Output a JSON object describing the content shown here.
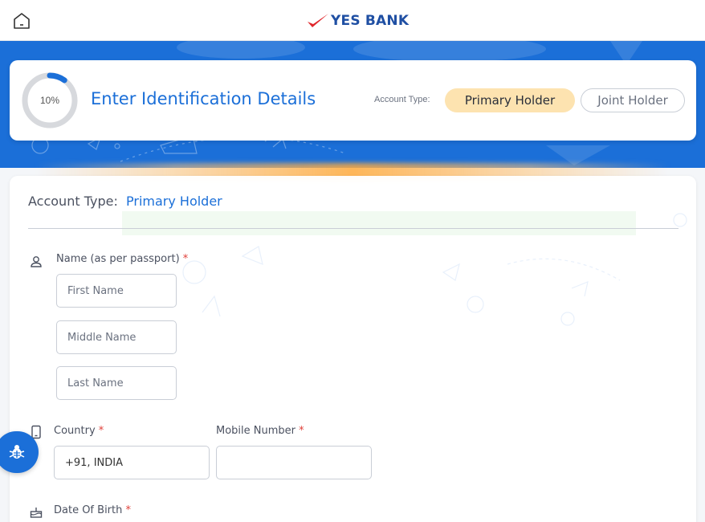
{
  "header": {
    "home_icon": "home-icon",
    "logo_text": "YES BANK",
    "brand_color": "#1f4fa3",
    "accent_color": "#e0262b"
  },
  "progress": {
    "percent_text": "10%",
    "fraction": 0.1,
    "title": "Enter Identification Details",
    "account_type_label": "Account Type:",
    "options": [
      "Primary Holder",
      "Joint Holder"
    ],
    "selected": "Primary Holder"
  },
  "form": {
    "account_type_label": "Account Type:",
    "account_type_value": "Primary Holder",
    "name": {
      "label": "Name (as per passport)",
      "required_mark": "*",
      "icon": "person-icon",
      "first_placeholder": "First Name",
      "middle_placeholder": "Middle Name",
      "last_placeholder": "Last Name"
    },
    "country": {
      "label": "Country",
      "required_mark": "*",
      "icon": "phone-icon",
      "value": "+91, INDIA"
    },
    "mobile": {
      "label": "Mobile Number",
      "required_mark": "*",
      "value": ""
    },
    "dob": {
      "label": "Date Of Birth",
      "required_mark": "*",
      "icon": "cake-icon"
    }
  },
  "floating": {
    "bug_icon": "bug-icon"
  },
  "colors": {
    "primary_blue": "#1b6fd8",
    "selected_pill": "#fde3b0",
    "required": "#e0413a"
  }
}
